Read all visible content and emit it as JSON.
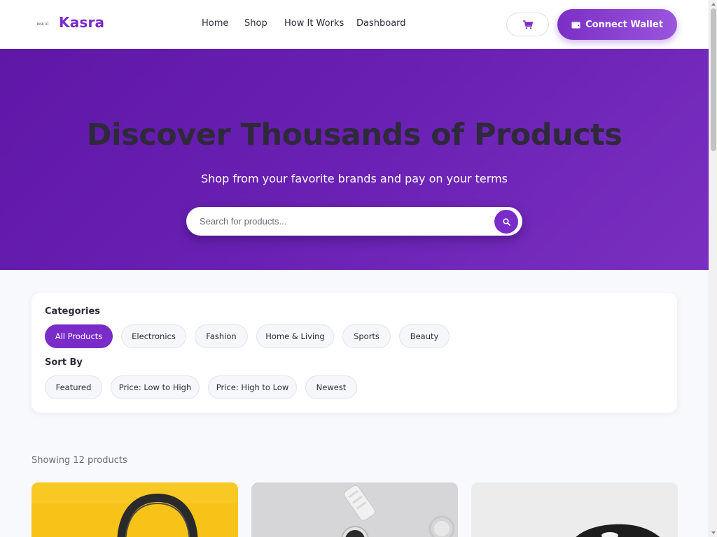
{
  "header": {
    "logo_text": "PUSH UI",
    "brand": "Kasra",
    "nav": [
      "Home",
      "Shop",
      "How It Works",
      "Dashboard"
    ],
    "cart_icon": "cart-icon",
    "wallet_icon": "wallet-icon",
    "wallet_label": "Connect Wallet"
  },
  "hero": {
    "title": "Discover Thousands of Products",
    "subtitle": "Shop from your favorite brands and pay on your terms",
    "search_placeholder": "Search for products...",
    "search_icon": "search-icon"
  },
  "filters": {
    "categories_label": "Categories",
    "categories": [
      "All Products",
      "Electronics",
      "Fashion",
      "Home & Living",
      "Sports",
      "Beauty"
    ],
    "active_category": "All Products",
    "sort_label": "Sort By",
    "sort_options": [
      "Featured",
      "Price: Low to High",
      "Price: High to Low",
      "Newest"
    ]
  },
  "results": {
    "showing_text": "Showing 12 products"
  },
  "colors": {
    "accent": "#7a2cc9",
    "hero_start": "#5f17a8",
    "hero_end": "#7a2fc0",
    "card1_bg": "#f7c318",
    "card2_bg": "#d6d6d8",
    "card3_bg": "#ececec"
  }
}
